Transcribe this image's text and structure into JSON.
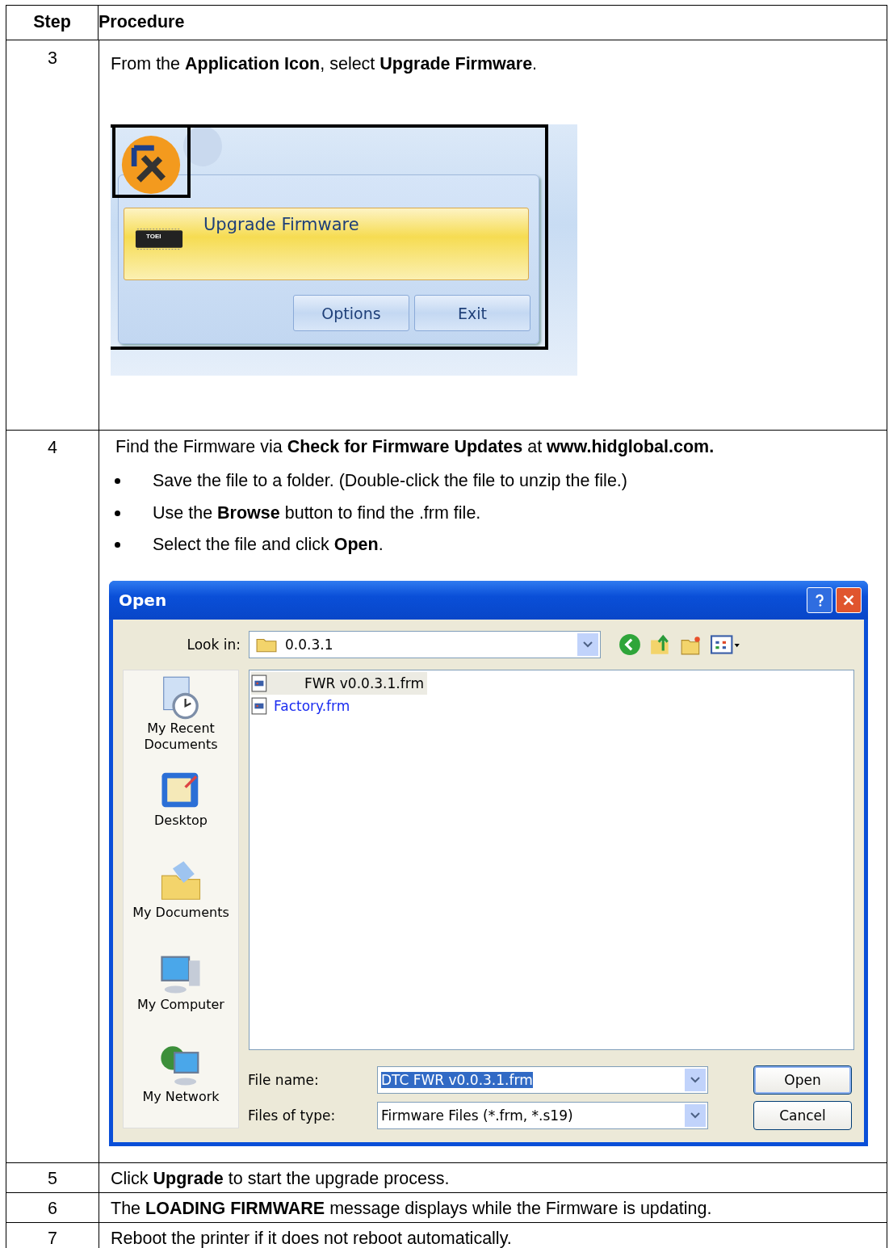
{
  "columns": [
    "Step",
    "Procedure"
  ],
  "rows": [
    {
      "step": "3",
      "kind": "app_menu",
      "text": "From the **Application Icon**, select **Upgrade Firmware**.",
      "menu": {
        "item": "Upgrade Firmware",
        "chip_label": "TOEI",
        "buttons": [
          "Options",
          "Exit"
        ]
      }
    },
    {
      "step": "4",
      "kind": "open_dialog",
      "text": "Find the Firmware via **Check for Firmware Updates** at **www.hidglobal.com.**",
      "bullets": [
        "Save the file to a folder. (Double-click the file to unzip the file.)",
        "Use the **Browse** button to find the .frm file.",
        "Select the file and click **Open**."
      ],
      "dialog": {
        "title": "Open",
        "look_in_label": "Look in:",
        "look_in": "0.0.3.1",
        "places": [
          "My Recent Documents",
          "Desktop",
          "My Documents",
          "My Computer",
          "My Network"
        ],
        "files": [
          {
            "name": "FWR v0.0.3.1.frm",
            "selected": true
          },
          {
            "name": "Factory.frm",
            "selected": false
          }
        ],
        "file_name_label": "File name:",
        "file_name": "DTC FWR v0.0.3.1.frm",
        "file_type_label": "Files of type:",
        "file_type": "Firmware Files (*.frm, *.s19)",
        "buttons": [
          "Open",
          "Cancel"
        ]
      }
    },
    {
      "step": "5",
      "kind": "text",
      "text": "Click **Upgrade** to start the upgrade process."
    },
    {
      "step": "6",
      "kind": "text",
      "text": "The **LOADING FIRMWARE** message displays while the Firmware is updating."
    },
    {
      "step": "7",
      "kind": "text",
      "text": "Reboot the printer if it does not reboot automatically."
    }
  ]
}
